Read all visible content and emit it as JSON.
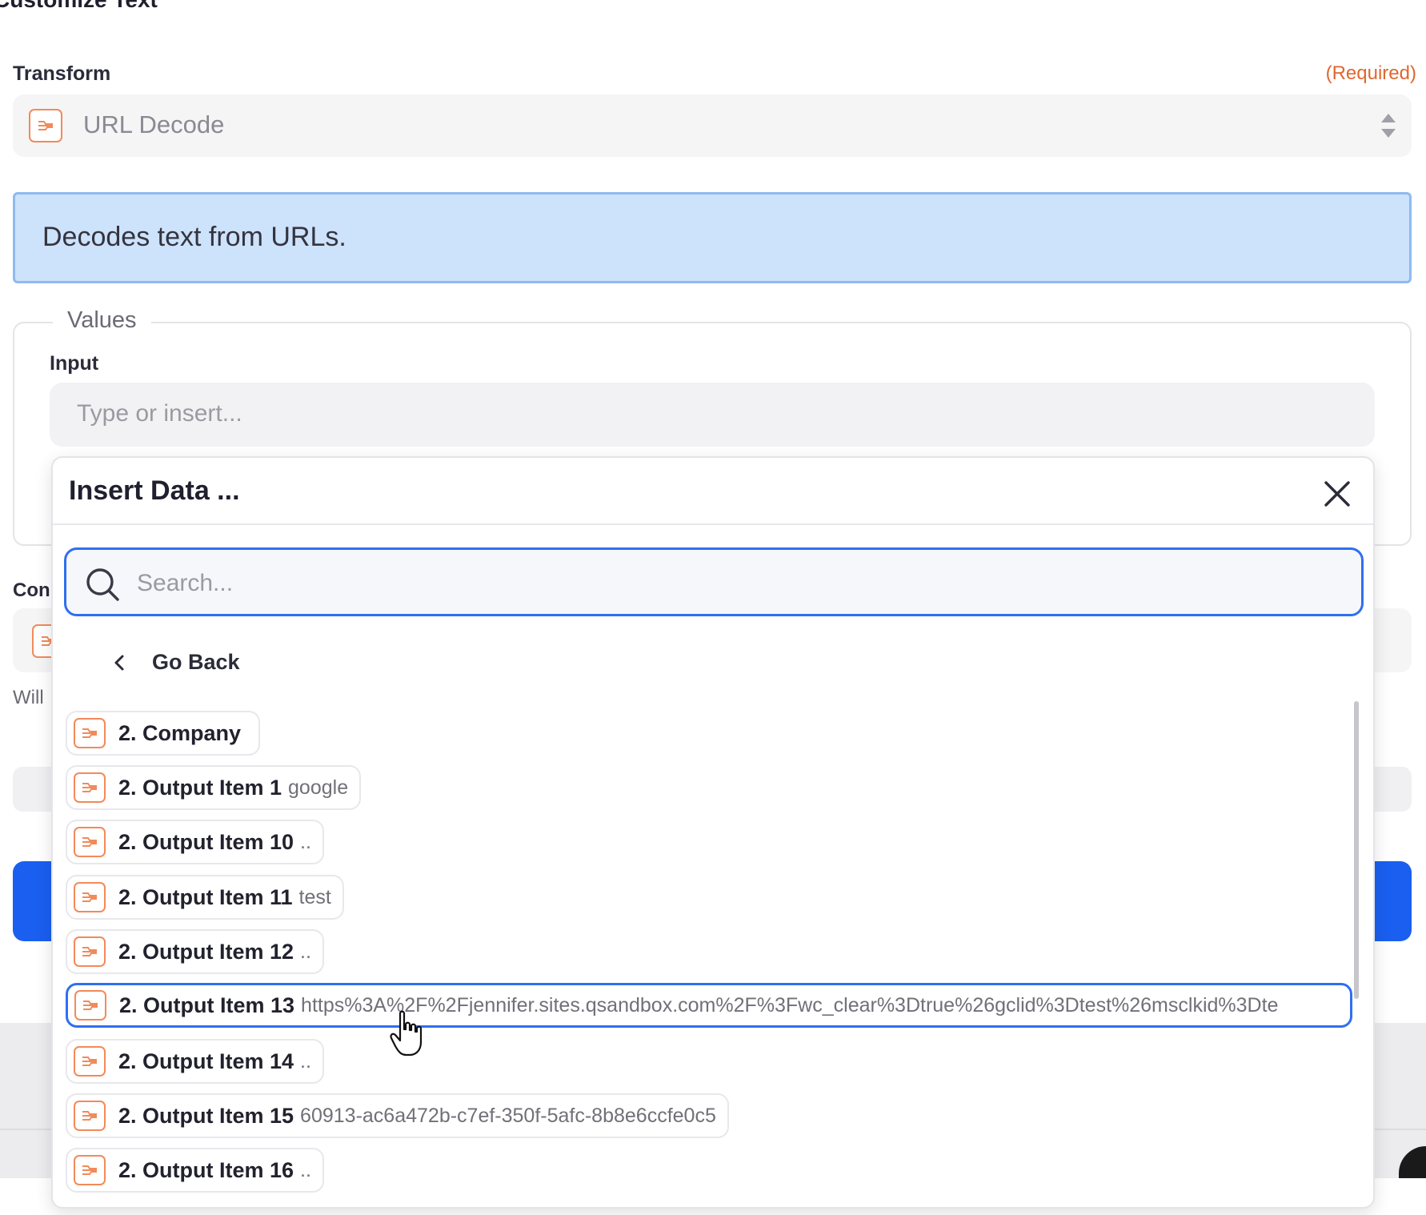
{
  "page": {
    "title": "Customize Text"
  },
  "transform": {
    "label": "Transform",
    "required": "(Required)",
    "value": "URL Decode",
    "icon": "formatter-app-icon",
    "info": "Decodes text from URLs."
  },
  "values": {
    "legend": "Values",
    "input_label": "Input",
    "input_placeholder": "Type or insert..."
  },
  "background": {
    "field_label_partial": "Con",
    "helper_partial": "Will"
  },
  "insert_data": {
    "title": "Insert Data ...",
    "search_placeholder": "Search...",
    "go_back": "Go Back",
    "items": [
      {
        "name": "2. Company",
        "value": ""
      },
      {
        "name": "2. Output Item 1",
        "value": "google"
      },
      {
        "name": "2. Output Item 10",
        "value": ".."
      },
      {
        "name": "2. Output Item 11",
        "value": "test"
      },
      {
        "name": "2. Output Item 12",
        "value": ".."
      },
      {
        "name": "2. Output Item 13",
        "value": "https%3A%2F%2Fjennifer.sites.qsandbox.com%2F%3Fwc_clear%3Dtrue%26gclid%3Dtest%26msclkid%3Dte",
        "selected": true
      },
      {
        "name": "2. Output Item 14",
        "value": ".."
      },
      {
        "name": "2. Output Item 15",
        "value": "60913-ac6a472b-c7ef-350f-5afc-8b8e6ccfe0c5"
      },
      {
        "name": "2. Output Item 16",
        "value": ".."
      }
    ]
  },
  "colors": {
    "accent": "#2f6ff0",
    "required": "#e0672f",
    "info_bg": "#cde2fb",
    "app_icon": "#f28a5a"
  }
}
